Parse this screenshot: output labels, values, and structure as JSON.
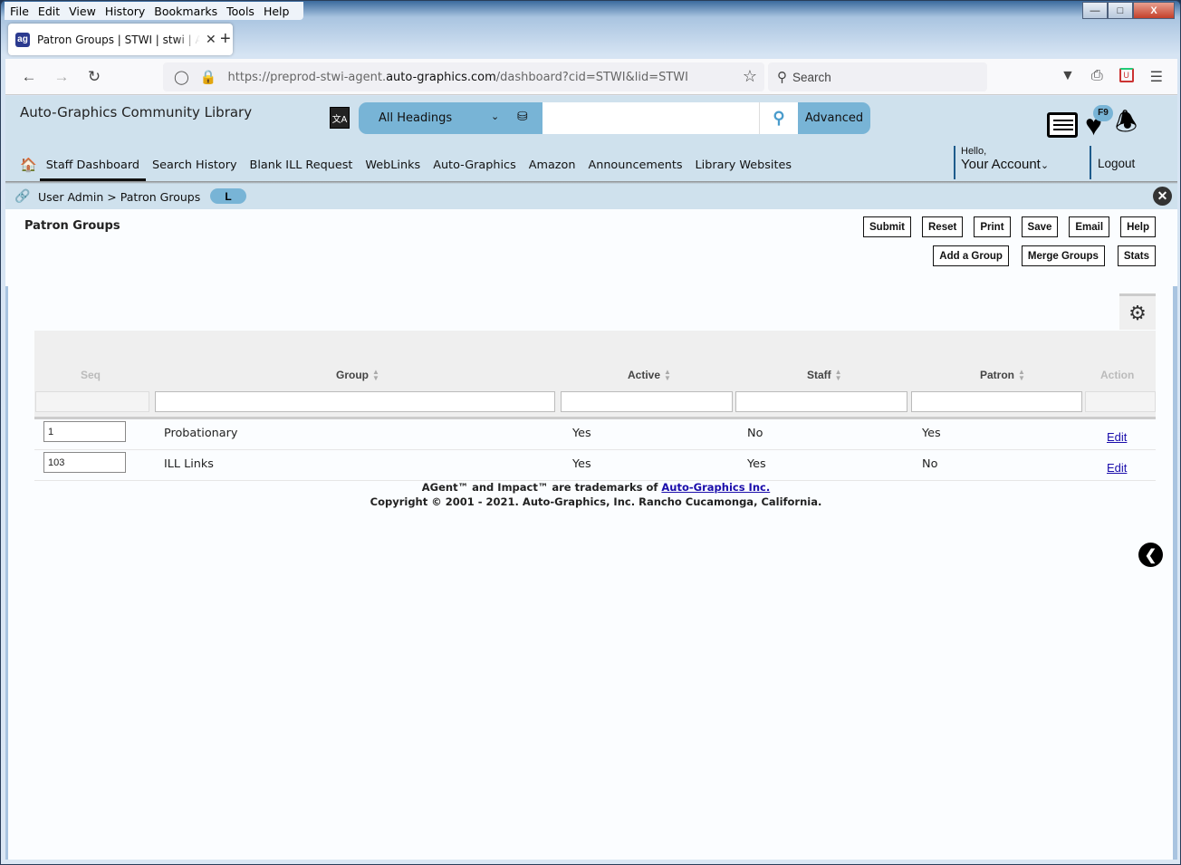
{
  "browser": {
    "menu": [
      "File",
      "Edit",
      "View",
      "History",
      "Bookmarks",
      "Tools",
      "Help"
    ],
    "tab_title": "Patron Groups | STWI | stwi | Auto-Graphics",
    "url_prefix": "https://preprod-stwi-agent.",
    "url_domain": "auto-graphics.com",
    "url_suffix": "/dashboard?cid=STWI&lid=STWI",
    "search_placeholder": "Search"
  },
  "header": {
    "library_name": "Auto-Graphics Community Library",
    "search_scope": "All Headings",
    "search_value": "",
    "advanced_label": "Advanced",
    "favorites_badge": "F9",
    "hello": "Hello,",
    "account": "Your Account",
    "logout": "Logout"
  },
  "nav": [
    "Staff Dashboard",
    "Search History",
    "Blank ILL Request",
    "WebLinks",
    "Auto-Graphics",
    "Amazon",
    "Announcements",
    "Library Websites"
  ],
  "breadcrumb": {
    "text": "User Admin > Patron Groups",
    "pill": "L"
  },
  "page": {
    "title": "Patron Groups",
    "buttons_row1": [
      "Submit",
      "Reset",
      "Print",
      "Save",
      "Email",
      "Help"
    ],
    "buttons_row2": [
      "Add a Group",
      "Merge Groups",
      "Stats"
    ]
  },
  "table": {
    "columns": [
      "Seq",
      "Group",
      "Active",
      "Staff",
      "Patron",
      "Action"
    ],
    "rows": [
      {
        "seq": "1",
        "group": "Probationary",
        "active": "Yes",
        "staff": "No",
        "patron": "Yes",
        "action": "Edit"
      },
      {
        "seq": "103",
        "group": "ILL Links",
        "active": "Yes",
        "staff": "Yes",
        "patron": "No",
        "action": "Edit"
      }
    ]
  },
  "footer": {
    "line1": "AGent™ and Impact™ are trademarks of ",
    "link": "Auto-Graphics Inc.",
    "line2": "Copyright © 2001 - 2021. Auto-Graphics, Inc. Rancho Cucamonga, California."
  }
}
